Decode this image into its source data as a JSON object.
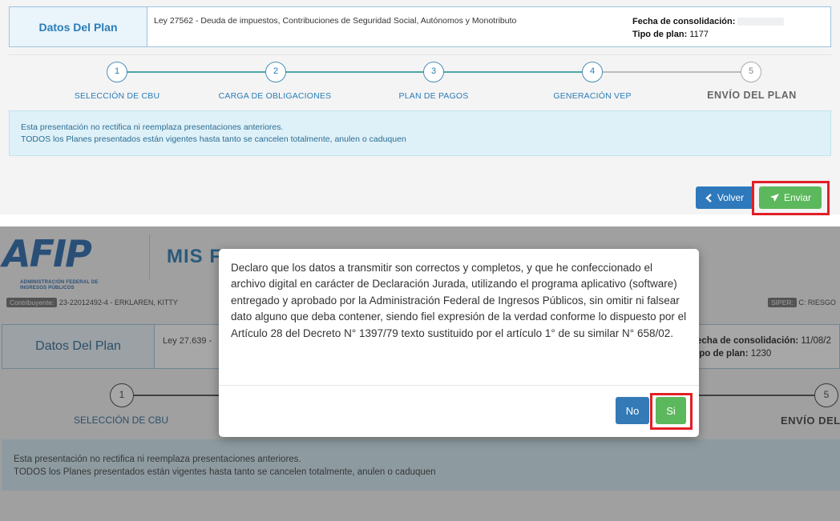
{
  "top": {
    "plan_title": "Datos Del Plan",
    "plan_ley": "Ley 27562 - Deuda de impuestos, Contribuciones de Seguridad Social, Autónomos y Monotributo",
    "fecha_label": "Fecha de consolidación:",
    "tipo_label": "Tipo de plan:",
    "tipo_value": "1177",
    "steps": [
      {
        "num": "1",
        "label": "SELECCIÓN DE CBU"
      },
      {
        "num": "2",
        "label": "CARGA DE OBLIGACIONES"
      },
      {
        "num": "3",
        "label": "PLAN DE PAGOS"
      },
      {
        "num": "4",
        "label": "GENERACIÓN VEP"
      },
      {
        "num": "5",
        "label": "ENVÍO DEL PLAN"
      }
    ],
    "info_line1": "Esta presentación no rectifica ni reemplaza presentaciones anteriores.",
    "info_line2": "TODOS los Planes presentados están vigentes hasta tanto se cancelen totalmente, anulen o caduquen",
    "btn_volver": "Volver",
    "btn_enviar": "Enviar"
  },
  "bottom": {
    "logo_text": "AFIP",
    "logo_sub1": "ADMINISTRACIÓN FEDERAL DE",
    "logo_sub2": "INGRESOS PÚBLICOS",
    "app_title": "MIS F",
    "contrib_tag": "Contribuyente:",
    "contrib_value": "23-22012492-4 - ERKLAREN, KITTY",
    "siper_tag": "SIPER:",
    "siper_value": "C: RIESGO",
    "plan_title": "Datos Del Plan",
    "plan_ley": "Ley 27.639 -",
    "fecha_label": "echa de consolidación:",
    "fecha_value": "11/08/2",
    "tipo_label": "ipo de plan:",
    "tipo_value": "1230",
    "step1_num": "1",
    "step1_label": "SELECCIÓN DE CBU",
    "step5_num": "5",
    "step5_label": "ENVÍO DEL",
    "info_line1": "Esta presentación no rectifica ni reemplaza presentaciones anteriores.",
    "info_line2": "TODOS los Planes presentados están vigentes hasta tanto se cancelen totalmente, anulen o caduquen",
    "modal_text": "Declaro que los datos a transmitir son correctos y completos, y que he confeccionado el archivo digital en carácter de Declaración Jurada, utilizando el programa aplicativo (software) entregado y aprobado por la Administración Federal de Ingresos Públicos, sin omitir ni falsear dato alguno que deba contener, siendo fiel expresión de la verdad conforme lo dispuesto por el Artículo 28 del Decreto N° 1397/79 texto sustituido por el artículo 1° de su similar N° 658/02.",
    "btn_no": "No",
    "btn_si": "Si"
  },
  "colors": {
    "primary": "#337ab7",
    "success": "#5cb85c",
    "highlight": "#e21f26"
  }
}
